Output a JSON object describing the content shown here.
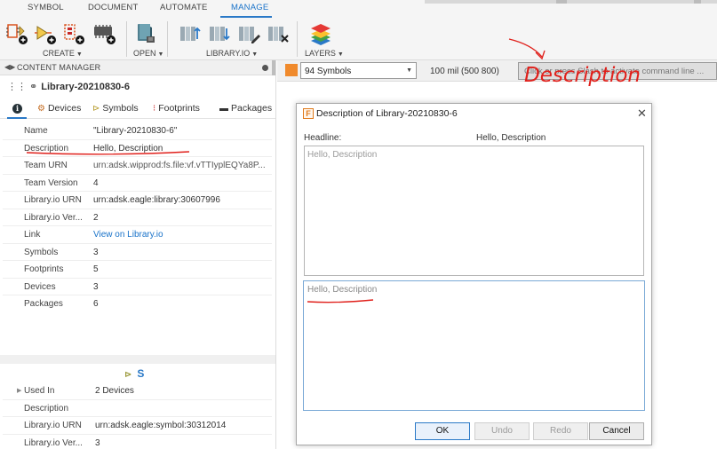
{
  "ribbon": {
    "tabs": [
      {
        "label": "SYMBOL"
      },
      {
        "label": "DOCUMENT"
      },
      {
        "label": "AUTOMATE"
      },
      {
        "label": "MANAGE"
      }
    ],
    "groups": {
      "create": "CREATE",
      "open": "OPEN",
      "library_io": "LIBRARY.IO",
      "layers": "LAYERS"
    },
    "icons": [
      "add-component-icon",
      "add-symbol-icon",
      "add-footprint-icon",
      "add-package-icon",
      "book-icon",
      "library-upload-icon",
      "library-download-icon",
      "library-edit-icon",
      "library-remove-icon",
      "layers-icon"
    ]
  },
  "content_manager": {
    "header": "CONTENT MANAGER",
    "library_title": "Library-20210830-6",
    "tabs": {
      "devices": "Devices",
      "symbols": "Symbols",
      "footprints": "Footprints",
      "packages": "Packages"
    },
    "properties": [
      {
        "key": "Name",
        "value": "\"Library-20210830-6\""
      },
      {
        "key": "Description",
        "value": "Hello, Description"
      },
      {
        "key": "Team URN",
        "value": "urn:adsk.wipprod:fs.file:vf.vTTIyplEQYa8P..."
      },
      {
        "key": "Team Version",
        "value": "4"
      },
      {
        "key": "Library.io URN",
        "value": "urn:adsk.eagle:library:30607996"
      },
      {
        "key": "Library.io Ver...",
        "value": "2"
      },
      {
        "key": "Link",
        "value": "View on Library.io"
      },
      {
        "key": "Symbols",
        "value": "3"
      },
      {
        "key": "Footprints",
        "value": "5"
      },
      {
        "key": "Devices",
        "value": "3"
      },
      {
        "key": "Packages",
        "value": "6"
      }
    ],
    "symbol_section": {
      "title": "S",
      "properties": [
        {
          "key": "Used In",
          "value": "2 Devices"
        },
        {
          "key": "Description",
          "value": ""
        },
        {
          "key": "Library.io URN",
          "value": "urn:adsk.eagle:symbol:30312014"
        },
        {
          "key": "Library.io Ver...",
          "value": "3"
        }
      ]
    }
  },
  "toolbar": {
    "symbols_select": "94 Symbols",
    "grid": "100 mil (500 800)",
    "command_placeholder": "Click or press Slash to activate command line ..."
  },
  "dialog": {
    "title": "Description of Library-20210830-6",
    "headline_label": "Headline:",
    "headline_value": "Hello, Description",
    "preview_text": "Hello, Description",
    "editor_text": "Hello, Description",
    "buttons": {
      "ok": "OK",
      "undo": "Undo",
      "redo": "Redo",
      "cancel": "Cancel"
    }
  },
  "annotation": {
    "handwritten_label": "Description",
    "color": "#e0201b"
  }
}
